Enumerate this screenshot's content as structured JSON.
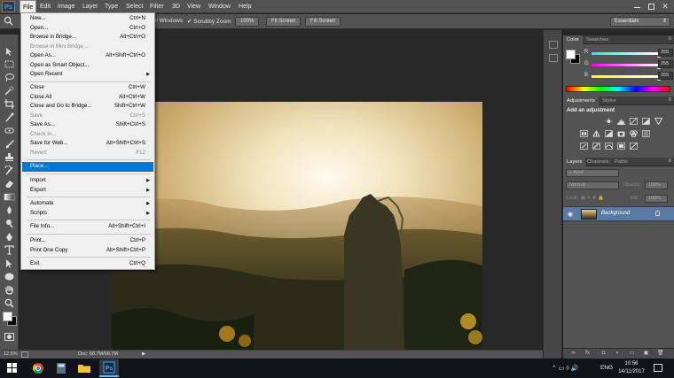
{
  "app": {
    "logo": "Ps"
  },
  "menubar": {
    "items": [
      "File",
      "Edit",
      "Image",
      "Layer",
      "Type",
      "Select",
      "Filter",
      "3D",
      "View",
      "Window",
      "Help"
    ]
  },
  "options_bar": {
    "all_windows_label": "ll Windows",
    "scrubby_zoom_label": "Scrubby Zoom",
    "zoom_100_label": "100%",
    "fit_screen_label": "Fit Screen",
    "fill_screen_label": "Fill Screen",
    "workspace": "Essentials"
  },
  "file_menu": {
    "items": [
      {
        "label": "New...",
        "shortcut": "Ctrl+N"
      },
      {
        "label": "Open...",
        "shortcut": "Ctrl+O"
      },
      {
        "label": "Browse in Bridge...",
        "shortcut": "Alt+Ctrl+O"
      },
      {
        "label": "Browse in Mini Bridge...",
        "shortcut": ""
      },
      {
        "label": "Open As...",
        "shortcut": "Alt+Shift+Ctrl+O"
      },
      {
        "label": "Open as Smart Object...",
        "shortcut": ""
      },
      {
        "label": "Open Recent",
        "shortcut": ""
      },
      {
        "label": "Close",
        "shortcut": "Ctrl+W"
      },
      {
        "label": "Close All",
        "shortcut": "Alt+Ctrl+W"
      },
      {
        "label": "Close and Go to Bridge...",
        "shortcut": "Shift+Ctrl+W"
      },
      {
        "label": "Save",
        "shortcut": "Ctrl+S"
      },
      {
        "label": "Save As...",
        "shortcut": "Shift+Ctrl+S"
      },
      {
        "label": "Check In...",
        "shortcut": ""
      },
      {
        "label": "Save for Web...",
        "shortcut": "Alt+Shift+Ctrl+S"
      },
      {
        "label": "Revert",
        "shortcut": "F12"
      },
      {
        "label": "Place...",
        "shortcut": ""
      },
      {
        "label": "Import",
        "shortcut": ""
      },
      {
        "label": "Export",
        "shortcut": ""
      },
      {
        "label": "Automate",
        "shortcut": ""
      },
      {
        "label": "Scripts",
        "shortcut": ""
      },
      {
        "label": "File Info...",
        "shortcut": "Alt+Shift+Ctrl+I"
      },
      {
        "label": "Print...",
        "shortcut": "Ctrl+P"
      },
      {
        "label": "Print One Copy",
        "shortcut": "Alt+Shift+Ctrl+P"
      },
      {
        "label": "Exit",
        "shortcut": "Ctrl+Q"
      }
    ]
  },
  "color_panel": {
    "tabs": [
      "Color",
      "Swatches"
    ],
    "channels": [
      {
        "label": "R",
        "value": "255",
        "level": 1.0
      },
      {
        "label": "G",
        "value": "255",
        "level": 1.0
      },
      {
        "label": "B",
        "value": "255",
        "level": 1.0
      }
    ]
  },
  "adjustments_panel": {
    "tabs": [
      "Adjustments",
      "Styles"
    ],
    "title": "Add an adjustment"
  },
  "layers_panel": {
    "tabs": [
      "Layers",
      "Channels",
      "Paths"
    ],
    "kind_label": "Kind",
    "blend_mode": "Normal",
    "opacity_label": "Opacity:",
    "opacity_value": "100%",
    "lock_label": "Lock:",
    "fill_label": "Fill:",
    "fill_value": "100%",
    "layer_name": "Background"
  },
  "status_bar": {
    "zoom": "12.5%",
    "doc_size": "Doc: 68.7M/68.7M"
  },
  "taskbar": {
    "language": "ENG",
    "time": "10:56",
    "date": "14/11/2017"
  }
}
